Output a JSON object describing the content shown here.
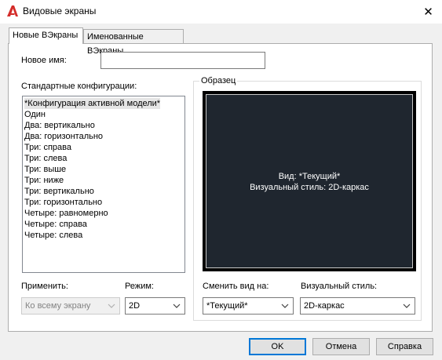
{
  "window": {
    "title": "Видовые экраны",
    "close_glyph": "✕"
  },
  "tabs": [
    {
      "label": "Новые ВЭкраны",
      "active": true
    },
    {
      "label": "Именованные ВЭкраны",
      "active": false
    }
  ],
  "new_name": {
    "label": "Новое имя:",
    "value": ""
  },
  "standard": {
    "label": "Стандартные конфигурации:",
    "items": [
      "*Конфигурация активной модели*",
      "Один",
      "Два: вертикально",
      "Два: горизонтально",
      "Три: справа",
      "Три: слева",
      "Три: выше",
      "Три: ниже",
      "Три: вертикально",
      "Три: горизонтально",
      "Четыре: равномерно",
      "Четыре: справа",
      "Четыре: слева"
    ],
    "selected_index": 0
  },
  "preview": {
    "label": "Образец",
    "line1": "Вид: *Текущий*",
    "line2": "Визуальный стиль: 2D-каркас"
  },
  "apply": {
    "label": "Применить:",
    "value": "Ко всему экрану",
    "disabled": true
  },
  "mode": {
    "label": "Режим:",
    "value": "2D"
  },
  "change_view": {
    "label": "Сменить вид на:",
    "value": "*Текущий*"
  },
  "visual_style": {
    "label": "Визуальный стиль:",
    "value": "2D-каркас"
  },
  "buttons": {
    "ok": "OK",
    "cancel": "Отмена",
    "help": "Справка"
  },
  "colors": {
    "app_icon": "#d42d2a",
    "preview_bg": "#1f262f",
    "primary_border": "#0078d7"
  },
  "icons": {
    "app": "autocad-a-icon",
    "close": "close-icon",
    "dropdown": "chevron-down-icon"
  }
}
